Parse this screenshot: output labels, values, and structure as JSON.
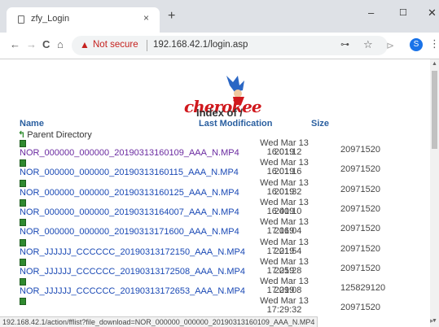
{
  "tab": {
    "title": "zfy_Login",
    "close": "×",
    "new_tab": "+"
  },
  "window_controls": {
    "minimize": "–",
    "maximize": "☐",
    "close": "✕"
  },
  "nav": {
    "back": "←",
    "forward": "→",
    "reload": "C",
    "home": "⌂"
  },
  "address": {
    "warning_icon": "▲",
    "security_label": "Not secure",
    "url": "192.168.42.1/login.asp"
  },
  "toolbar_icons": {
    "key": "⊶",
    "star": "☆",
    "extension": "⊳",
    "profile": "S",
    "menu": "⋮"
  },
  "page": {
    "logo_text": "cherokee",
    "index_title": "Index of /",
    "headers": {
      "name": "Name",
      "modified": "Last Modification",
      "size": "Size"
    },
    "parent": "Parent Directory",
    "files": [
      {
        "name": "NOR_000000_000000_20190313160109_AAA_N.MP4",
        "modified_a": "Wed Mar 13 16:01:12",
        "modified_b": "2019",
        "size": "20971520"
      },
      {
        "name": "NOR_000000_000000_20190313160115_AAA_N.MP4",
        "modified_a": "Wed Mar 13 16:01:16",
        "modified_b": "2019",
        "size": "20971520"
      },
      {
        "name": "NOR_000000_000000_20190313160125_AAA_N.MP4",
        "modified_a": "Wed Mar 13 16:01:32",
        "modified_b": "2019",
        "size": "20971520"
      },
      {
        "name": "NOR_000000_000000_20190313164007_AAA_N.MP4",
        "modified_a": "Wed Mar 13 16:40:10",
        "modified_b": "2019",
        "size": "20971520"
      },
      {
        "name": "NOR_000000_000000_20190313171600_AAA_N.MP4",
        "modified_a": "Wed Mar 13 17:16:04",
        "modified_b": "2019",
        "size": "20971520"
      },
      {
        "name": "NOR_JJJJJJ_CCCCCC_20190313172150_AAA_N.MP4",
        "modified_a": "Wed Mar 13 17:21:54",
        "modified_b": "2019",
        "size": "20971520"
      },
      {
        "name": "NOR_JJJJJJ_CCCCCC_20190313172508_AAA_N.MP4",
        "modified_a": "Wed Mar 13 17:25:28",
        "modified_b": "2019",
        "size": "20971520"
      },
      {
        "name": "NOR_JJJJJJ_CCCCCC_20190313172653_AAA_N.MP4",
        "modified_a": "Wed Mar 13 17:29:08",
        "modified_b": "2019",
        "size": "125829120"
      },
      {
        "name": "",
        "modified_a": "Wed Mar 13 17:29:32",
        "modified_b": "",
        "size": "20971520"
      }
    ]
  },
  "status_url": "192.168.42.1/action/fflist?file_download=NOR_000000_000000_20190313160109_AAA_N.MP4"
}
